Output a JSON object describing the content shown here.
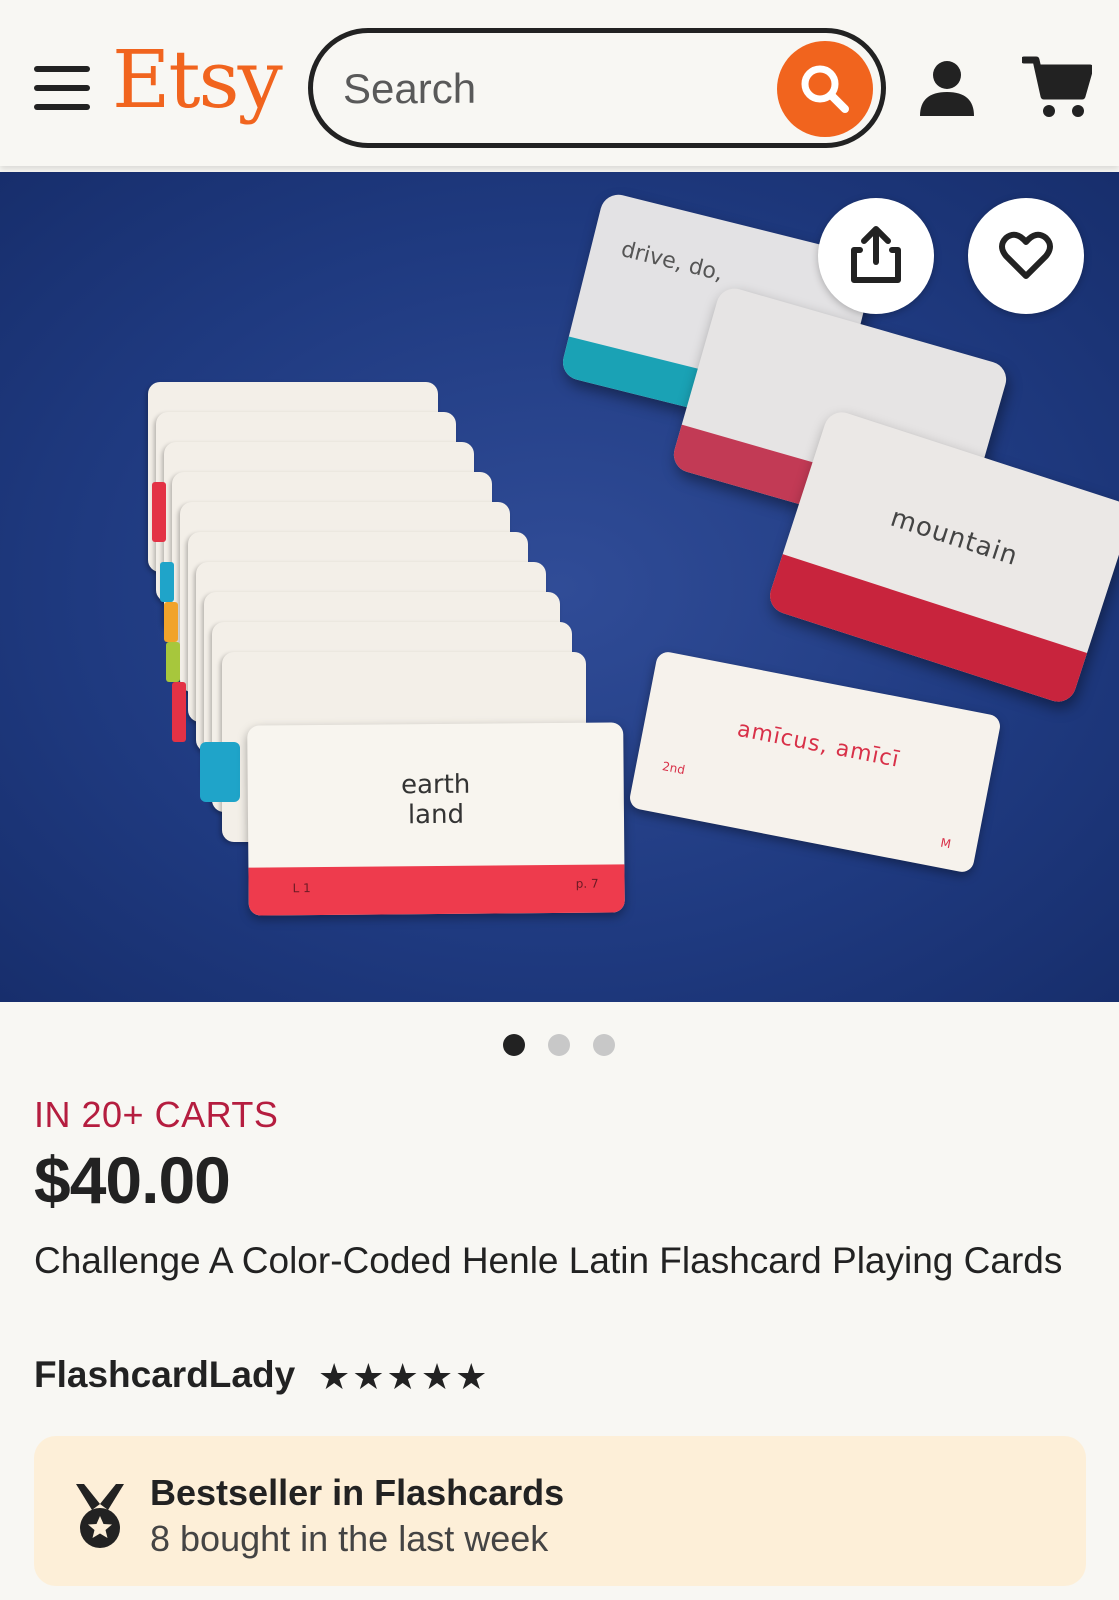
{
  "header": {
    "logo": "Etsy",
    "search_placeholder": "Search",
    "brand_color": "#f1641e"
  },
  "hero": {
    "cards": {
      "front_card_lines": [
        "earth",
        "land"
      ],
      "front_card_lesson": "L 1",
      "front_card_page": "p. 7",
      "loose_card_word": "amīcus, amīcī",
      "loose_card_declension": "2nd",
      "loose_card_gender": "M",
      "box_card_word": "mountain",
      "back_box_word": "drive, do,"
    },
    "share_icon": "share-icon",
    "favorite_icon": "heart-icon"
  },
  "carousel": {
    "total": 3,
    "active_index": 0
  },
  "product": {
    "carts_text": "IN 20+ CARTS",
    "price": "$40.00",
    "title": "Challenge A Color-Coded Henle Latin Flashcard Playing Cards",
    "shop_name": "FlashcardLady",
    "rating_stars": "★★★★★",
    "rating_value": 5
  },
  "bestseller": {
    "title": "Bestseller in Flashcards",
    "subtitle": "8 bought in the last week"
  },
  "colors": {
    "carts_text": "#b51d3f",
    "bestseller_bg": "#fdefd8",
    "card_band": "#ee3b4d"
  }
}
